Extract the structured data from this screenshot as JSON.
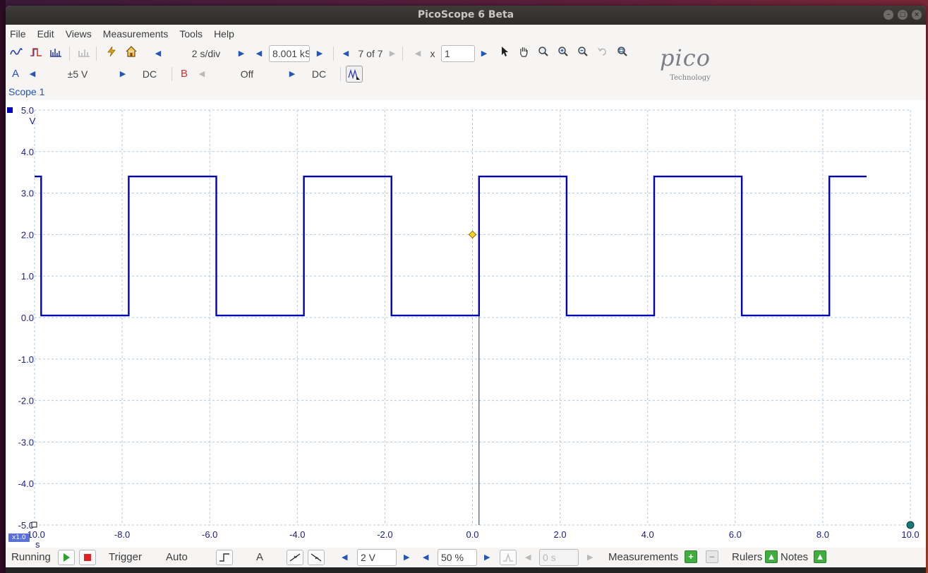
{
  "window": {
    "title": "PicoScope 6 Beta"
  },
  "menu": [
    "File",
    "Edit",
    "Views",
    "Measurements",
    "Tools",
    "Help"
  ],
  "toolbar": {
    "timebase": "2 s/div",
    "samples": "8.001 kS",
    "capture_index": "7 of 7",
    "zoom_prefix": "x",
    "zoom_value": "1"
  },
  "channels": {
    "a": {
      "name": "A",
      "range": "±5 V",
      "coupling": "DC"
    },
    "b": {
      "name": "B",
      "range": "Off",
      "coupling": "DC"
    }
  },
  "logo": {
    "brand": "pico",
    "tagline": "Technology"
  },
  "scope": {
    "title": "Scope 1",
    "y_unit": "V",
    "x_unit": "s",
    "zoom_badge": "x1.0"
  },
  "chart_data": {
    "type": "line",
    "series": [
      {
        "name": "A",
        "color": "#0000b4",
        "x": [
          -10.0,
          -9.85,
          -9.85,
          -7.85,
          -7.85,
          -5.85,
          -5.85,
          -3.85,
          -3.85,
          -1.85,
          -1.85,
          0.15,
          0.15,
          2.15,
          2.15,
          4.15,
          4.15,
          6.15,
          6.15,
          8.15,
          8.15,
          9.0
        ],
        "y": [
          3.4,
          3.4,
          0.05,
          0.05,
          3.4,
          3.4,
          0.05,
          0.05,
          3.4,
          3.4,
          0.05,
          0.05,
          3.4,
          3.4,
          0.05,
          0.05,
          3.4,
          3.4,
          0.05,
          0.05,
          3.4,
          3.4
        ]
      }
    ],
    "xlim": [
      -10.0,
      10.0
    ],
    "ylim": [
      -5.0,
      5.0
    ],
    "x_ticks": [
      "-10.0",
      "-8.0",
      "-6.0",
      "-4.0",
      "-2.0",
      "0.0",
      "2.0",
      "4.0",
      "6.0",
      "8.0",
      "10.0"
    ],
    "y_ticks": [
      "5.0",
      "4.0",
      "3.0",
      "2.0",
      "1.0",
      "0.0",
      "-1.0",
      "-2.0",
      "-3.0",
      "-4.0",
      "-5.0"
    ],
    "grid": true,
    "trigger_marker": {
      "x": 0.0,
      "y": 2.0
    }
  },
  "statusbar": {
    "state": "Running",
    "trigger_label": "Trigger",
    "trigger_mode": "Auto",
    "trigger_channel": "A",
    "threshold": "2 V",
    "pre_trigger": "50 %",
    "delay": "0 s",
    "measurements_label": "Measurements",
    "rulers_label": "Rulers",
    "notes_label": "Notes"
  },
  "colors": {
    "accent": "#2455b8",
    "trace": "#0000b4",
    "axis_text": "#1b1b8f",
    "grid": "#a9cde8",
    "titlebar": "#2e2d2a"
  }
}
